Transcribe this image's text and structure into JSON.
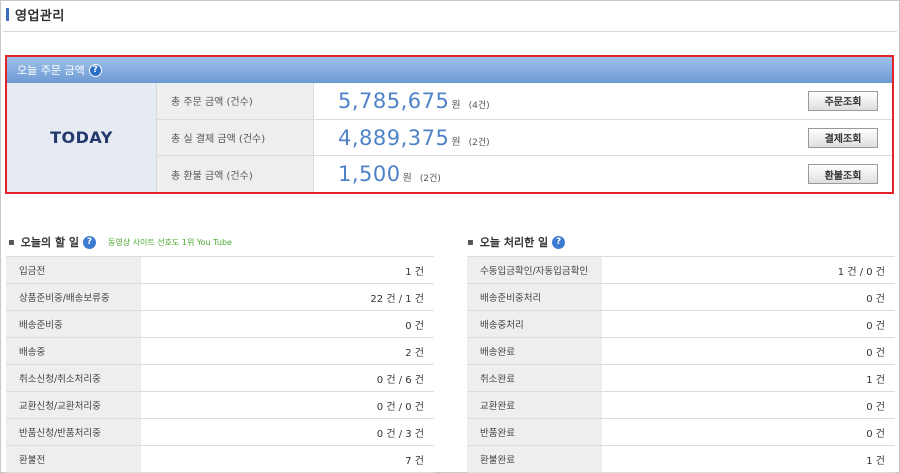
{
  "page": {
    "title": "영업관리"
  },
  "today": {
    "header": "오늘 주문 금액",
    "label": "TODAY",
    "rows": [
      {
        "label": "총 주문 금액 (건수)",
        "amount": "5,785,675",
        "unit": "원",
        "count": "(4건)",
        "button": "주문조회"
      },
      {
        "label": "총 실 결제 금액 (건수)",
        "amount": "4,889,375",
        "unit": "원",
        "count": "(2건)",
        "button": "결제조회"
      },
      {
        "label": "총 환불 금액 (건수)",
        "amount": "1,500",
        "unit": "원",
        "count": "(2건)",
        "button": "환불조회"
      }
    ]
  },
  "todo": {
    "title": "오늘의 할 일",
    "link": "동영상 사이트 선호도 1위 You Tube",
    "rows": [
      {
        "label": "입금전",
        "value": "1 건"
      },
      {
        "label": "상품준비중/배송보류중",
        "value": "22 건 / 1 건"
      },
      {
        "label": "배송준비중",
        "value": "0 건"
      },
      {
        "label": "배송중",
        "value": "2 건"
      },
      {
        "label": "취소신청/취소처리중",
        "value": "0 건 / 6 건"
      },
      {
        "label": "교환신청/교환처리중",
        "value": "0 건 / 0 건"
      },
      {
        "label": "반품신청/반품처리중",
        "value": "0 건 / 3 건"
      },
      {
        "label": "환불전",
        "value": "7 건"
      }
    ]
  },
  "done": {
    "title": "오늘 처리한 일",
    "rows": [
      {
        "label": "수동입금확인/자동입금확인",
        "value": "1 건 / 0 건"
      },
      {
        "label": "배송준비중처리",
        "value": "0 건"
      },
      {
        "label": "배송중처리",
        "value": "0 건"
      },
      {
        "label": "배송완료",
        "value": "0 건"
      },
      {
        "label": "취소완료",
        "value": "1 건"
      },
      {
        "label": "교환완료",
        "value": "0 건"
      },
      {
        "label": "반품완료",
        "value": "0 건"
      },
      {
        "label": "환불완료",
        "value": "1 건"
      }
    ]
  },
  "icons": {
    "help": "help-question-icon",
    "bullet": "bullet-icon"
  },
  "colors": {
    "highlight_border": "#e2232a",
    "amount": "#4f83c8",
    "header_blue": "#6d9ad4",
    "link_green": "#4aa82e"
  }
}
